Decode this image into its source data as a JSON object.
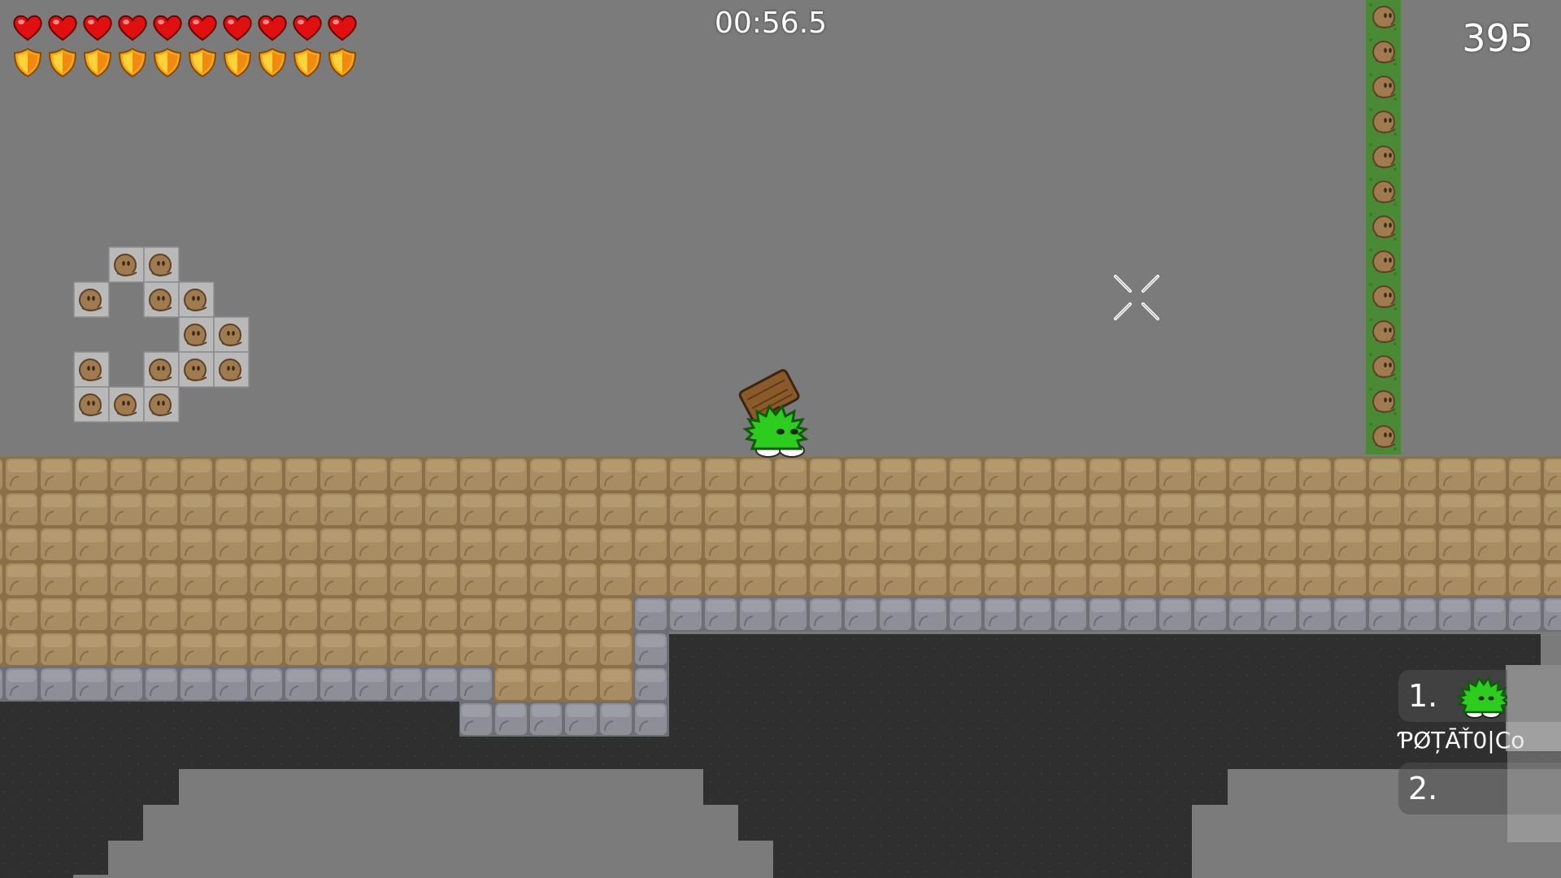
{
  "hud": {
    "timer": "00:56.5",
    "score": "395",
    "health": {
      "current": 10,
      "max": 10
    },
    "armor": {
      "current": 10,
      "max": 10
    }
  },
  "scoreboard": {
    "entries": [
      {
        "rank": "1.",
        "name": "ƤØȚĀŤ0|Co"
      },
      {
        "rank": "2.",
        "name": ""
      }
    ]
  },
  "icons": {
    "health": "heart-icon",
    "armor": "shield-icon",
    "crosshair": "crosshair-icon",
    "player": "green-tee-player",
    "weapon": "hammer-icon"
  },
  "colors": {
    "sky": "#7b7b7b",
    "dirt": "#a68a60",
    "stone": "#8e8e96",
    "cave": "#2e2e2e",
    "freeze": "#4c8a38",
    "tee": "#2ecc1e"
  }
}
